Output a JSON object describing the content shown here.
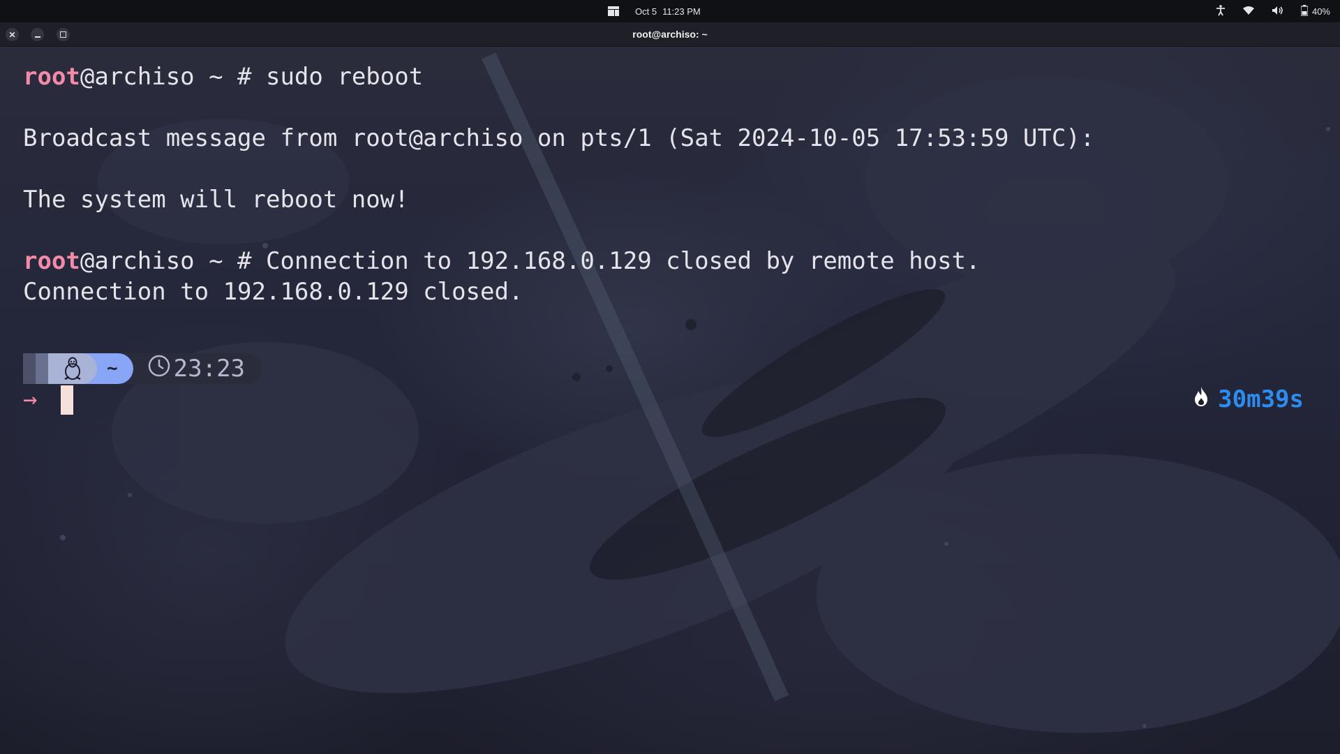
{
  "topbar": {
    "activities_icon": "window-overview-icon",
    "date": "Oct 5",
    "time": "11:23 PM",
    "tray": {
      "accessibility_icon": "accessibility-icon",
      "wifi_icon": "wifi-icon",
      "volume_icon": "volume-icon",
      "battery_icon": "battery-icon",
      "battery_percent": "40%"
    }
  },
  "window": {
    "title": "root@archiso: ~",
    "buttons": [
      "close",
      "minimize",
      "restore"
    ]
  },
  "terminal": {
    "lines": [
      {
        "user": "root",
        "rest": "@archiso ~ # sudo reboot"
      },
      {
        "text": "Broadcast message from root@archiso on pts/1 (Sat 2024-10-05 17:53:59 UTC):"
      },
      {
        "text": "The system will reboot now!"
      },
      {
        "user": "root",
        "rest": "@archiso ~ # Connection to 192.168.0.129 closed by remote host."
      },
      {
        "text": "Connection to 192.168.0.129 closed."
      }
    ],
    "prompt": {
      "os_icon": "linux-penguin-icon",
      "directory": "~",
      "clock_icon": "clock-icon",
      "clock": "23:23",
      "arrow": "→"
    },
    "last_command_duration": {
      "icon": "flame-icon",
      "value": "30m39s"
    }
  },
  "colors": {
    "user": "#f38ba8",
    "text": "#e4e4ea",
    "dir_segment": "#89a6f6",
    "duration": "#2d8cf0",
    "cursor": "#f5e0dc"
  }
}
